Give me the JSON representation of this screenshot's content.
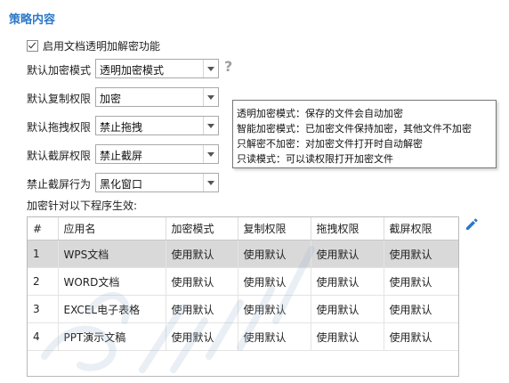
{
  "section": {
    "title": "策略内容"
  },
  "enable_checkbox": {
    "label": "启用文档透明加解密功能",
    "checked": true
  },
  "fields": [
    {
      "label": "默认加密模式",
      "value": "透明加密模式"
    },
    {
      "label": "默认复制权限",
      "value": "加密"
    },
    {
      "label": "默认拖拽权限",
      "value": "禁止拖拽"
    },
    {
      "label": "默认截屏权限",
      "value": "禁止截屏"
    },
    {
      "label": "禁止截屏行为",
      "value": "黑化窗口"
    }
  ],
  "help": {
    "glyph": "?"
  },
  "tooltip": {
    "lines": [
      "透明加密模式：保存的文件会自动加密",
      "智能加密模式：已加密文件保持加密，其他文件不加密",
      "只解密不加密：对加密文件打开时自动解密",
      "只读模式：可以读权限打开加密文件"
    ]
  },
  "table_caption": "加密针对以下程序生效:",
  "table": {
    "headers": [
      "#",
      "应用名",
      "加密模式",
      "复制权限",
      "拖拽权限",
      "截屏权限"
    ],
    "rows": [
      [
        "1",
        "WPS文档",
        "使用默认",
        "使用默认",
        "使用默认",
        "使用默认"
      ],
      [
        "2",
        "WORD文档",
        "使用默认",
        "使用默认",
        "使用默认",
        "使用默认"
      ],
      [
        "3",
        "EXCEL电子表格",
        "使用默认",
        "使用默认",
        "使用默认",
        "使用默认"
      ],
      [
        "4",
        "PPT演示文稿",
        "使用默认",
        "使用默认",
        "使用默认",
        "使用默认"
      ]
    ],
    "selected_row": 0
  },
  "edit_icon": "pencil-icon",
  "colors": {
    "accent": "#2b78c8",
    "selected_row": "#d9d9d9"
  }
}
